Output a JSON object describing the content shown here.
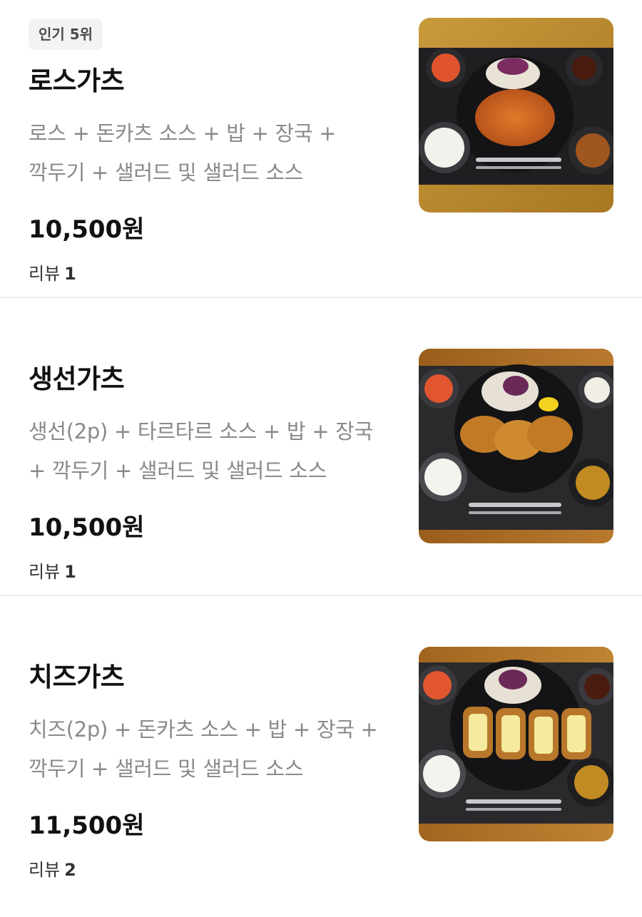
{
  "menu": {
    "items": [
      {
        "badge": "인기 5위",
        "name": "로스가츠",
        "desc_line1": "로스 + 돈카츠 소스 + 밥 + 장국 +",
        "desc_line2": "깍두기 + 샐러드 및 샐러드 소스",
        "price": "10,500원",
        "review_label": "리뷰",
        "review_count": "1",
        "photo": "loin-cutlet-set-photo"
      },
      {
        "name": "생선가츠",
        "desc_line1": "생선(2p) + 타르타르 소스 + 밥 + 장국",
        "desc_line2": "+ 깍두기 + 샐러드 및 샐러드 소스",
        "price": "10,500원",
        "review_label": "리뷰",
        "review_count": "1",
        "photo": "fish-cutlet-set-photo"
      },
      {
        "name": "치즈가츠",
        "desc_line1": "치즈(2p) + 돈카츠 소스 + 밥 + 장국 +",
        "desc_line2": "깍두기 + 샐러드 및 샐러드 소스",
        "price": "11,500원",
        "review_label": "리뷰",
        "review_count": "2",
        "photo": "cheese-cutlet-set-photo"
      }
    ]
  },
  "colors": {
    "background": "#ffffff",
    "divider": "#f1f1f3",
    "badge_bg": "#f2f3f5",
    "title": "#111111",
    "description": "#8a8a8a"
  }
}
